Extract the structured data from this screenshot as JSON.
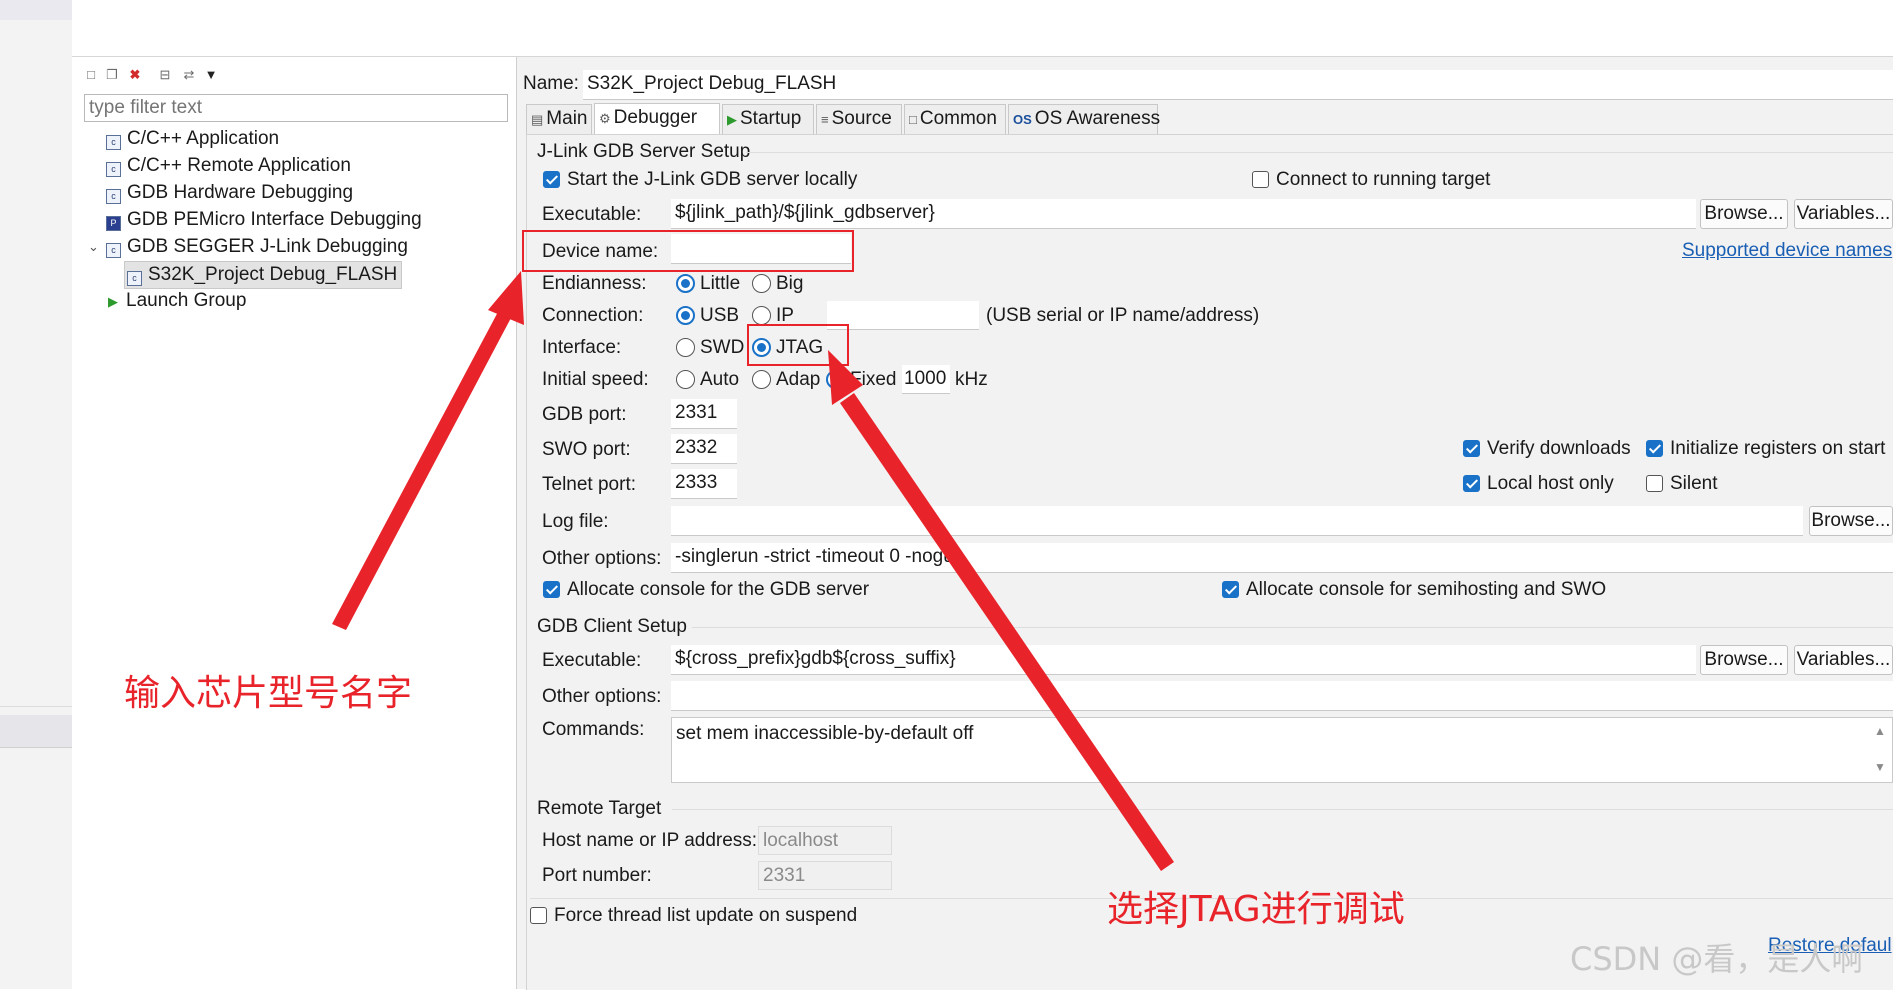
{
  "left_panel": {
    "filter_placeholder": "type filter text",
    "toolbar_icons": [
      "new-config-icon",
      "duplicate-icon",
      "delete-icon",
      "collapse-all-icon",
      "filter-icon",
      "view-menu-icon"
    ],
    "tree": [
      {
        "label": "C/C++ Application",
        "icon": "config-type-icon",
        "level": 0
      },
      {
        "label": "C/C++ Remote Application",
        "icon": "config-type-icon",
        "level": 0
      },
      {
        "label": "GDB Hardware Debugging",
        "icon": "config-type-icon",
        "level": 0
      },
      {
        "label": "GDB PEMicro Interface Debugging",
        "icon": "pemicro-icon",
        "level": 0
      },
      {
        "label": "GDB SEGGER J-Link Debugging",
        "icon": "config-type-icon",
        "level": 0,
        "expanded": true
      },
      {
        "label": "S32K_Project Debug_FLASH",
        "icon": "config-icon",
        "level": 1,
        "selected": true
      },
      {
        "label": "Launch Group",
        "icon": "launch-group-icon",
        "level": 0
      }
    ]
  },
  "config": {
    "name_label": "Name:",
    "name_value": "S32K_Project Debug_FLASH",
    "tabs": [
      {
        "label": "Main",
        "icon": "main-tab-icon"
      },
      {
        "label": "Debugger",
        "icon": "debugger-tab-icon",
        "active": true
      },
      {
        "label": "Startup",
        "icon": "startup-tab-icon"
      },
      {
        "label": "Source",
        "icon": "source-tab-icon"
      },
      {
        "label": "Common",
        "icon": "common-tab-icon"
      },
      {
        "label": "OS Awareness",
        "icon": "os-awareness-icon"
      }
    ]
  },
  "server": {
    "group_title": "J-Link GDB Server Setup",
    "start_locally_label": "Start the J-Link GDB server locally",
    "start_locally_checked": true,
    "connect_running_label": "Connect to running target",
    "connect_running_checked": false,
    "executable_label": "Executable:",
    "executable_value": "${jlink_path}/${jlink_gdbserver}",
    "browse_label": "Browse...",
    "variables_label": "Variables...",
    "device_name_label": "Device name:",
    "device_name_value": "",
    "supported_devices_link": "Supported device names",
    "endianness_label": "Endianness:",
    "endianness_options": [
      "Little",
      "Big"
    ],
    "endianness_selected": "Little",
    "connection_label": "Connection:",
    "connection_options": [
      "USB",
      "IP"
    ],
    "connection_selected": "USB",
    "connection_hint": "(USB serial or IP name/address)",
    "interface_label": "Interface:",
    "interface_options": [
      "SWD",
      "JTAG"
    ],
    "interface_selected": "JTAG",
    "speed_label": "Initial speed:",
    "speed_options": [
      "Auto",
      "Adap",
      "Fixed"
    ],
    "speed_selected": "Fixed",
    "speed_value": "1000",
    "speed_unit": "kHz",
    "gdb_port_label": "GDB port:",
    "gdb_port_value": "2331",
    "swo_port_label": "SWO port:",
    "swo_port_value": "2332",
    "telnet_port_label": "Telnet port:",
    "telnet_port_value": "2333",
    "verify_downloads_label": "Verify downloads",
    "verify_downloads_checked": true,
    "init_registers_label": "Initialize registers on start",
    "init_registers_checked": true,
    "local_host_label": "Local host only",
    "local_host_checked": true,
    "silent_label": "Silent",
    "silent_checked": false,
    "log_file_label": "Log file:",
    "log_file_value": "",
    "other_options_label": "Other options:",
    "other_options_value": "-singlerun -strict -timeout 0 -nogui",
    "allocate_gdb_label": "Allocate console for the GDB server",
    "allocate_gdb_checked": true,
    "allocate_semihosting_label": "Allocate console for semihosting and SWO",
    "allocate_semihosting_checked": true
  },
  "client": {
    "group_title": "GDB Client Setup",
    "executable_label": "Executable:",
    "executable_value": "${cross_prefix}gdb${cross_suffix}",
    "browse_label": "Browse...",
    "variables_label": "Variables...",
    "other_options_label": "Other options:",
    "other_options_value": "",
    "commands_label": "Commands:",
    "commands_value": "set mem inaccessible-by-default off"
  },
  "remote": {
    "group_title": "Remote Target",
    "host_label": "Host name or IP address:",
    "host_value": "localhost",
    "port_label": "Port number:",
    "port_value": "2331"
  },
  "footer": {
    "force_thread_label": "Force thread list update on suspend",
    "force_thread_checked": false,
    "restore_defaults_link": "Restore defaul"
  },
  "annotations": {
    "device_hint": "输入芯片型号名字",
    "jtag_hint": "选择JTAG进行调试",
    "color": "#e8232a"
  },
  "watermark": "CSDN @看，是人啊"
}
